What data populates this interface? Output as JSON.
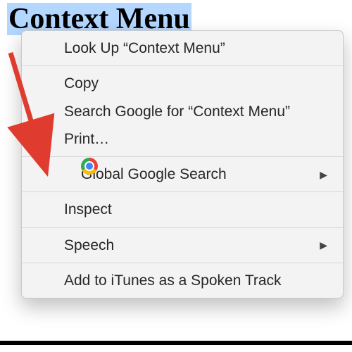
{
  "page": {
    "selected_text": "Context Menu"
  },
  "menu": {
    "lookup": "Look Up “Context Menu”",
    "copy": "Copy",
    "search_google": "Search Google for “Context Menu”",
    "print": "Print…",
    "global_search": "Global Google Search",
    "inspect": "Inspect",
    "speech": "Speech",
    "add_itunes": "Add to iTunes as a Spoken Track",
    "submenu_glyph": "▶"
  },
  "annotation": {
    "arrow_color": "#e03b2f"
  }
}
